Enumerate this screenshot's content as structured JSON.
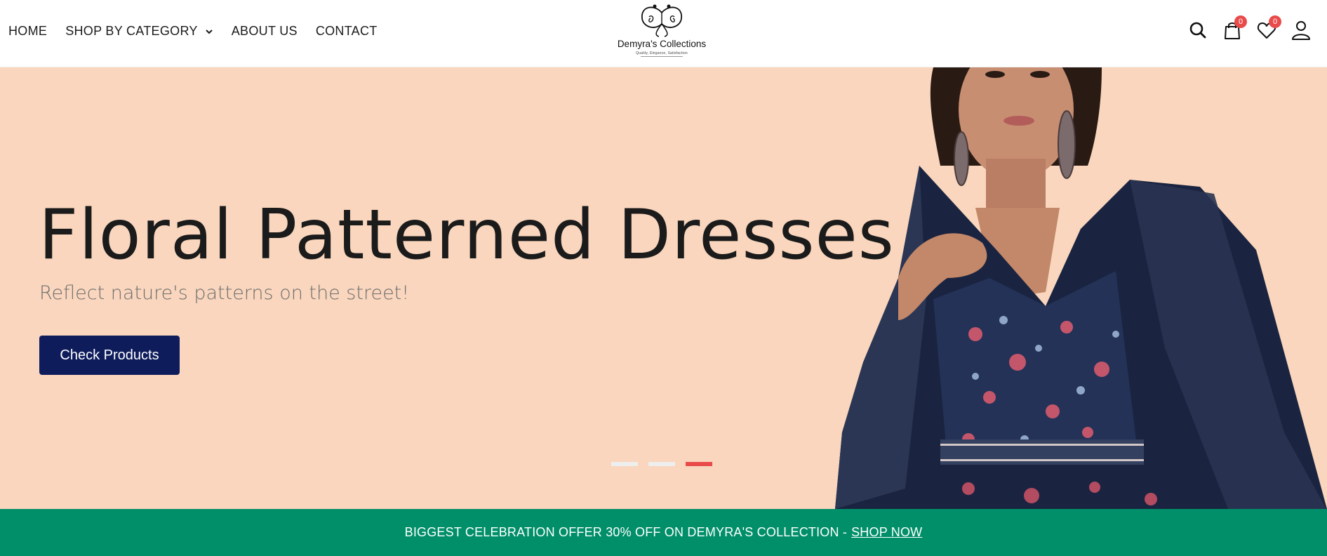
{
  "nav": {
    "home": "HOME",
    "shop_by_category": "SHOP BY CATEGORY",
    "about_us": "ABOUT US",
    "contact": "CONTACT"
  },
  "logo": {
    "brand": "Demyra's Collections",
    "tagline": "Quality, Elegance, Satisfaction"
  },
  "header_icons": {
    "search": "search-icon",
    "cart": "shopping-bag-icon",
    "wishlist": "heart-icon",
    "account": "user-icon",
    "cart_count": "0",
    "wishlist_count": "0"
  },
  "hero": {
    "title": "Floral Patterned Dresses",
    "subtitle": "Reflect nature's patterns on the street!",
    "button_label": "Check Products",
    "slide_count": 3,
    "active_slide": 3,
    "background": "#f9d6bd",
    "button_color": "#0e1c5c"
  },
  "promo": {
    "text": "BIGGEST CELEBRATION OFFER 30% OFF ON DEMYRA'S COLLECTION -",
    "link": "SHOP NOW",
    "background": "#008f69"
  },
  "colors": {
    "accent": "#e94b4b"
  }
}
